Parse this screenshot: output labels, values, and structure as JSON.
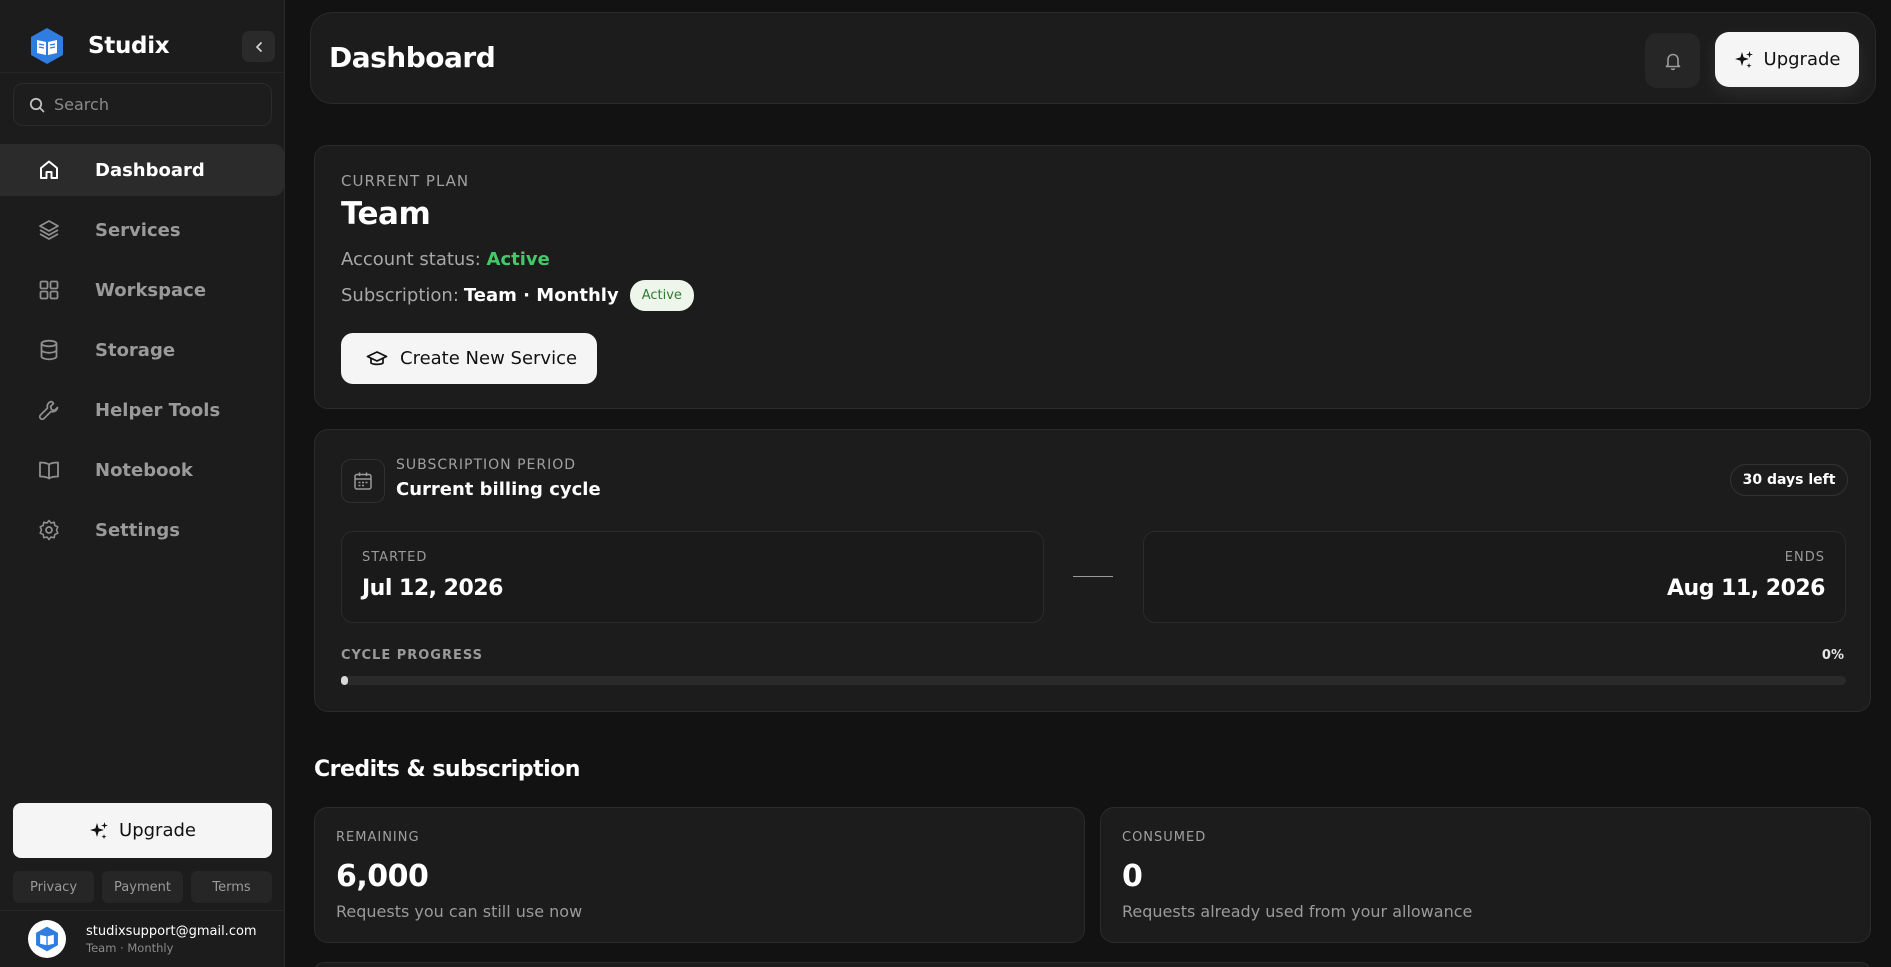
{
  "app": {
    "name": "Studix"
  },
  "search": {
    "placeholder": "Search"
  },
  "sidebar": {
    "items": [
      {
        "label": "Dashboard",
        "icon": "home-icon",
        "active": true
      },
      {
        "label": "Services",
        "icon": "layers-icon"
      },
      {
        "label": "Workspace",
        "icon": "grid-icon"
      },
      {
        "label": "Storage",
        "icon": "database-icon"
      },
      {
        "label": "Helper Tools",
        "icon": "wrench-icon"
      },
      {
        "label": "Notebook",
        "icon": "book-icon"
      },
      {
        "label": "Settings",
        "icon": "gear-icon"
      }
    ],
    "upgrade_label": "Upgrade",
    "footer_links": [
      "Privacy",
      "Payment",
      "Terms"
    ],
    "user": {
      "email": "studixsupport@gmail.com",
      "plan": "Team · Monthly"
    }
  },
  "header": {
    "title": "Dashboard",
    "upgrade_label": "Upgrade"
  },
  "plan": {
    "eyebrow": "CURRENT PLAN",
    "name": "Team",
    "status_label": "Account status:",
    "status_value": "Active",
    "subscription_label": "Subscription:",
    "subscription_value": "Team · Monthly",
    "subscription_badge": "Active",
    "create_button": "Create New Service"
  },
  "period": {
    "eyebrow": "SUBSCRIPTION PERIOD",
    "title": "Current billing cycle",
    "days_left": "30 days left",
    "started_label": "STARTED",
    "started_value": "Jul 12, 2026",
    "ends_label": "ENDS",
    "ends_value": "Aug 11, 2026",
    "progress_label": "CYCLE PROGRESS",
    "progress_text": "0%",
    "progress_fraction": 0
  },
  "credits": {
    "section_title": "Credits & subscription",
    "remaining": {
      "label": "REMAINING",
      "value": "6,000",
      "desc": "Requests you can still use now"
    },
    "consumed": {
      "label": "CONSUMED",
      "value": "0",
      "desc": "Requests already used from your allowance"
    }
  },
  "colors": {
    "accent_green": "#45c86a",
    "brand_blue": "#2f7de1",
    "background": "#121212",
    "surface": "#1c1c1c"
  }
}
